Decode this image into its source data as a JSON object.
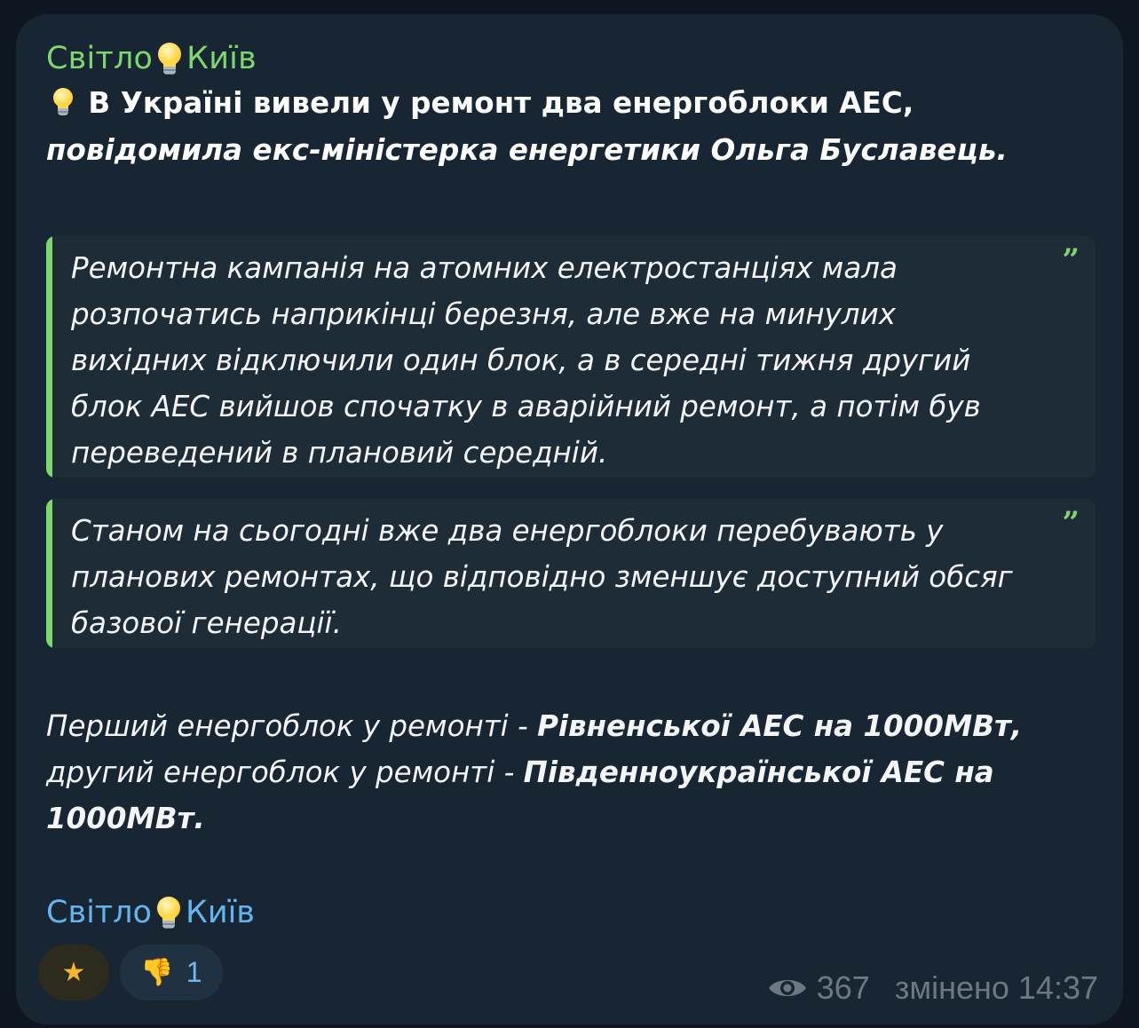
{
  "post": {
    "author": {
      "name_part1": "Світло",
      "name_part2": "Київ",
      "icon": "light-bulb-icon",
      "color": "#7ed66f"
    },
    "headline": {
      "bold_text": "В Україні вивели у ремонт два енергоблоки АЕС,",
      "bold_italic_text": "повідомила екс-міністерка енергетики Ольга Буславець."
    },
    "quotes": [
      {
        "text": "Ремонтна кампанія на атомних електростанціях мала розпочатись наприкінці березня, але вже на минулих вихідних відключили один блок, а в середні тижня другий блок АЕС вийшов спочатку в аварійний ремонт, а потім був переведений в плановий середній.",
        "mark": "”"
      },
      {
        "text": "Станом на сьогодні вже два енергоблоки перебувають у планових ремонтах, що відповідно зменшує доступний обсяг базової генерації.",
        "mark": "”"
      }
    ],
    "paragraph": {
      "part1": "Перший енергоблок у ремонті - ",
      "part1_bold": "Рівненської АЕС на 1000МВт,",
      "part2": "другий енергоблок у ремонті - ",
      "part2_bold": "Південноукраїнської АЕС на 1000МВт."
    },
    "signature": {
      "name_part1": "Світло",
      "name_part2": "Київ",
      "color": "#64b5ef"
    },
    "reactions": [
      {
        "icon": "star-icon",
        "emoji": "★",
        "count": ""
      },
      {
        "icon": "thumbs-down-icon",
        "emoji": "👎",
        "count": "1"
      }
    ],
    "meta": {
      "views": "367",
      "edited_label": "змінено",
      "time": "14:37"
    }
  },
  "colors": {
    "background": "#0e1621",
    "bubble": "#182533",
    "quote_bg": "#1e2c38",
    "accent_green": "#7ed66f",
    "link_blue": "#64b5ef",
    "meta_gray": "#6d7883"
  }
}
